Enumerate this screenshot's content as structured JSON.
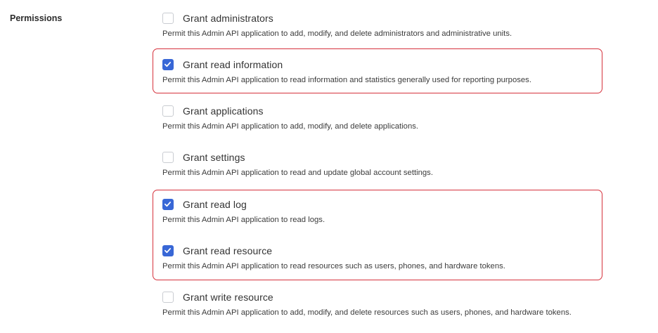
{
  "section": {
    "label": "Permissions"
  },
  "permissions": [
    {
      "label": "Grant administrators",
      "checked": false,
      "description": "Permit this Admin API application to add, modify, and delete administrators and administrative units."
    },
    {
      "label": "Grant read information",
      "checked": true,
      "description": "Permit this Admin API application to read information and statistics generally used for reporting purposes."
    },
    {
      "label": "Grant applications",
      "checked": false,
      "description": "Permit this Admin API application to add, modify, and delete applications."
    },
    {
      "label": "Grant settings",
      "checked": false,
      "description": "Permit this Admin API application to read and update global account settings."
    },
    {
      "label": "Grant read log",
      "checked": true,
      "description": "Permit this Admin API application to read logs."
    },
    {
      "label": "Grant read resource",
      "checked": true,
      "description": "Permit this Admin API application to read resources such as users, phones, and hardware tokens."
    },
    {
      "label": "Grant write resource",
      "checked": false,
      "description": "Permit this Admin API application to add, modify, and delete resources such as users, phones, and hardware tokens."
    }
  ],
  "colors": {
    "checkbox_checked": "#3867d6",
    "checkbox_border": "#c9ccd1",
    "highlight_border": "#d6313c"
  }
}
